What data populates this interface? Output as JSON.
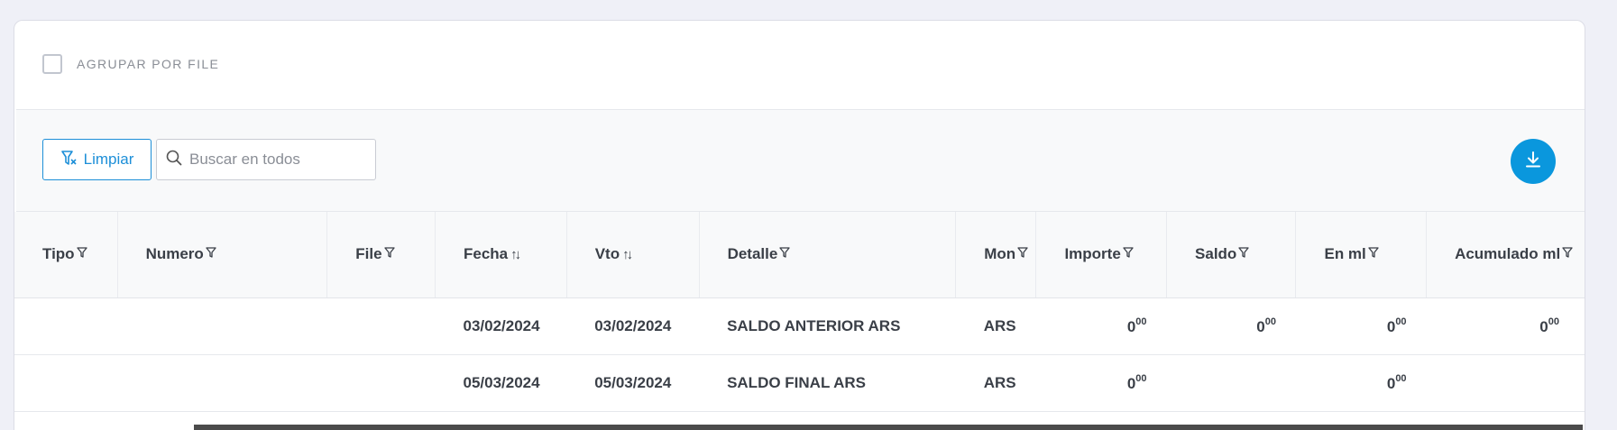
{
  "group": {
    "label": "AGRUPAR POR FILE",
    "checked": false
  },
  "toolbar": {
    "clear_label": "Limpiar",
    "search_placeholder": "Buscar en todos",
    "download_icon": "download-icon"
  },
  "colors": {
    "accent": "#0a97dd",
    "outline": "#1d8fd8",
    "header_bg": "#f8f9fa",
    "page_bg": "#eff0f7"
  },
  "table": {
    "columns": [
      {
        "label": "Tipo",
        "control": "filter"
      },
      {
        "label": "Numero",
        "control": "filter"
      },
      {
        "label": "File",
        "control": "filter"
      },
      {
        "label": "Fecha",
        "control": "sort"
      },
      {
        "label": "Vto",
        "control": "sort"
      },
      {
        "label": "Detalle",
        "control": "filter"
      },
      {
        "label": "Mon",
        "control": "filter"
      },
      {
        "label": "Importe",
        "control": "filter"
      },
      {
        "label": "Saldo",
        "control": "filter"
      },
      {
        "label": "En ml",
        "control": "filter"
      },
      {
        "label": "Acumulado ml",
        "control": "filter"
      }
    ],
    "rows": [
      {
        "tipo": "",
        "numero": "",
        "file": "",
        "fecha": "03/02/2024",
        "vto": "03/02/2024",
        "detalle": "SALDO ANTERIOR ARS",
        "mon": "ARS",
        "importe": {
          "int": "0",
          "dec": "00"
        },
        "saldo": {
          "int": "0",
          "dec": "00"
        },
        "en_ml": {
          "int": "0",
          "dec": "00"
        },
        "acumulado_ml": {
          "int": "0",
          "dec": "00"
        }
      },
      {
        "tipo": "",
        "numero": "",
        "file": "",
        "fecha": "05/03/2024",
        "vto": "05/03/2024",
        "detalle": "SALDO FINAL ARS",
        "mon": "ARS",
        "importe": {
          "int": "0",
          "dec": "00"
        },
        "saldo": {
          "int": "",
          "dec": ""
        },
        "en_ml": {
          "int": "0",
          "dec": "00"
        },
        "acumulado_ml": {
          "int": "",
          "dec": ""
        }
      }
    ]
  }
}
